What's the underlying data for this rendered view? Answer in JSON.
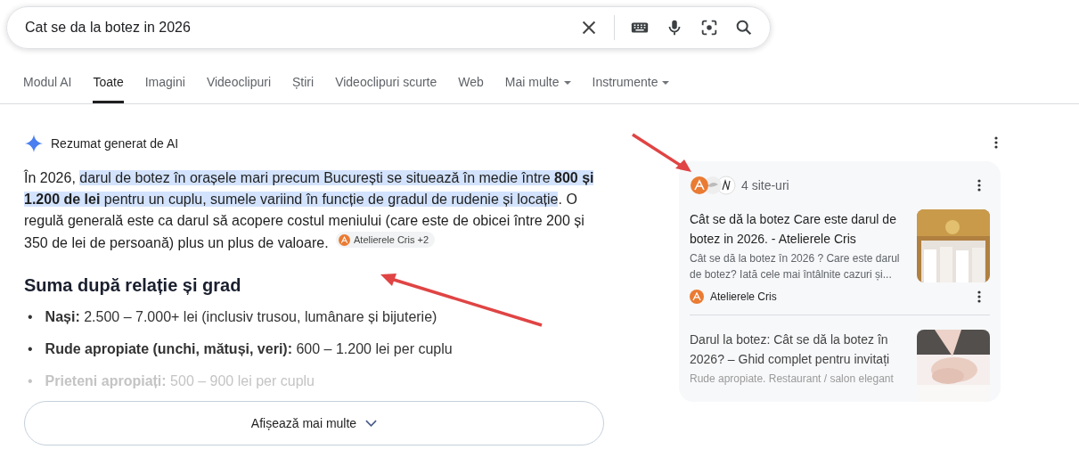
{
  "search": {
    "value": "Cat se da la botez in 2026"
  },
  "tabs": [
    {
      "label": "Modul AI",
      "selected": false,
      "dropdown": false
    },
    {
      "label": "Toate",
      "selected": true,
      "dropdown": false
    },
    {
      "label": "Imagini",
      "selected": false,
      "dropdown": false
    },
    {
      "label": "Videoclipuri",
      "selected": false,
      "dropdown": false
    },
    {
      "label": "Știri",
      "selected": false,
      "dropdown": false
    },
    {
      "label": "Videoclipuri scurte",
      "selected": false,
      "dropdown": false
    },
    {
      "label": "Web",
      "selected": false,
      "dropdown": false
    },
    {
      "label": "Mai multe",
      "selected": false,
      "dropdown": true
    },
    {
      "label": "Instrumente",
      "selected": false,
      "dropdown": true
    }
  ],
  "ai_overview": {
    "label": "Rezumat generat de AI",
    "paragraph": [
      {
        "text": "În 2026, ",
        "highlighted": false
      },
      {
        "text": "darul de botez în orașele mari precum București se situează în medie între **800 și 1.200 de lei** pentru un cuplu, sumele variind în funcție de gradul de rudenie și locație",
        "highlighted": true
      },
      {
        "text": ". O regulă generală este ca darul să acopere costul meniului (care este de obicei între 200 și 350 de lei de persoană) plus un plus de valoare. ",
        "highlighted": false
      }
    ],
    "source_chip": "Atelierele Cris +2",
    "heading": "Suma după relație și grad",
    "items": [
      {
        "bullet": "•",
        "term": "Nași:",
        "text": " 2.500 – 7.000+ lei (inclusiv trusou, lumânare și bijuterie)",
        "faded": false
      },
      {
        "bullet": "•",
        "term": "Rude apropiate (unchi, mătuși, veri):",
        "text": " 600 – 1.200 lei per cuplu",
        "faded": false
      },
      {
        "bullet": "•",
        "term": "Prieteni apropiați:",
        "text": " 500 – 900 lei per cuplu",
        "faded": true
      }
    ],
    "show_more": "Afișează mai multe"
  },
  "sources": {
    "count": "4 site-uri",
    "cards": [
      {
        "title": "Cât se dă la botez Care este darul de botez in 2026. - Atelierele Cris",
        "snippet": "Cât se dă la botez în 2026 ? Care este darul de botez? Iată cele mai întâlnite cazuri și...",
        "site": "Atelierele Cris",
        "faded": false
      },
      {
        "title": "Darul la botez: Cât se dă la botez în 2026? – Ghid complet pentru invitați",
        "snippet": "Rude apropiate. Restaurant / salon elegant",
        "faded": true
      }
    ]
  }
}
